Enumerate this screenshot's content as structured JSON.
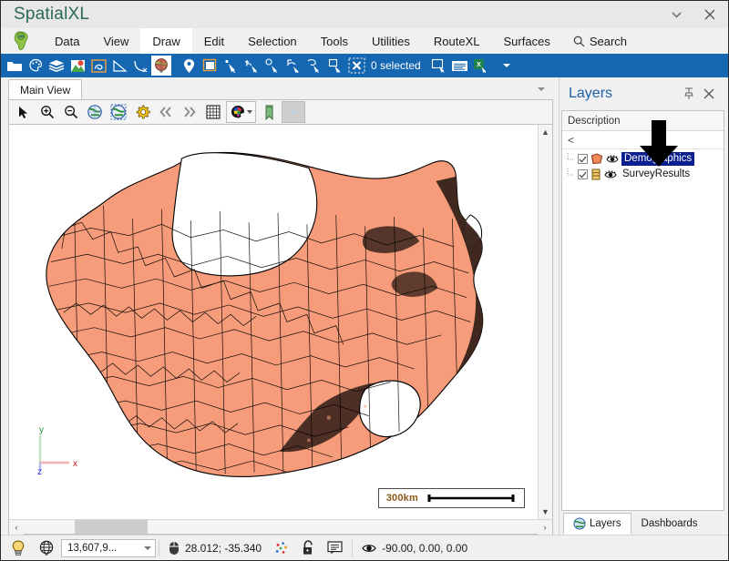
{
  "window": {
    "title": "SpatialXL",
    "minimize_label": "▾",
    "close_label": "✕"
  },
  "menu": {
    "app_icon": "africa-globe-icon",
    "items": [
      {
        "label": "Data",
        "active": false
      },
      {
        "label": "View",
        "active": true
      },
      {
        "label": "Draw",
        "active": false
      },
      {
        "label": "Edit",
        "active": false
      },
      {
        "label": "Selection",
        "active": false
      },
      {
        "label": "Tools",
        "active": false
      },
      {
        "label": "Utilities",
        "active": false
      },
      {
        "label": "RouteXL",
        "active": false
      },
      {
        "label": "Surfaces",
        "active": false
      }
    ],
    "search_label": "Search",
    "search_icon": "search-icon"
  },
  "ribbon": {
    "background": "#1567b2",
    "selection_count": "0 selected",
    "icons": [
      "open-folder-icon",
      "palette-pin-icon",
      "layers-stack-icon",
      "map-pin-image-icon",
      "browse-data-icon",
      "measure-angle-icon",
      "measure-curve-icon",
      "globe-icon",
      "place-marker-icon",
      "image-frame-icon",
      "select-point-icon",
      "select-move-icon",
      "select-rect-icon",
      "select-circle-icon",
      "select-lasso-icon",
      "select-box-icon",
      "clear-selection-icon",
      "duplicate-selection-icon",
      "table-view-icon",
      "export-excel-icon",
      "ribbon-overflow-caret"
    ]
  },
  "view_tabs": {
    "tabs": [
      {
        "label": "Main View",
        "active": true
      }
    ],
    "overflow_icon": "chevron-down-icon"
  },
  "view_toolbar": {
    "icons": [
      "arrow-select-icon",
      "zoom-in-icon",
      "zoom-out-icon",
      "globe-zoom-extent-icon",
      "globe-zoom-selection-icon",
      "settings-gear-icon",
      "previous-extent-icon",
      "next-extent-icon",
      "grid-icon",
      "color-theme-icon",
      "bookmark-icon",
      "sparkle-icon"
    ]
  },
  "map": {
    "background": "#ffffff",
    "polygon_fill": "#f79c7a",
    "polygon_dense_fill": "#3a241c",
    "polygon_stroke": "#000000",
    "scalebar_text": "300km",
    "axis": {
      "x_label": "x",
      "x_color": "#e02020",
      "y_label": "y",
      "y_color": "#1b8f2e",
      "z_label": "z",
      "z_color": "#2222dd"
    },
    "vscroll": {
      "up": "▲",
      "down": "▼"
    },
    "hscroll": {
      "left": "‹",
      "right": "›"
    }
  },
  "layers_panel": {
    "title": "Layers",
    "pin_icon": "pin-icon",
    "close_icon": "close-icon",
    "column_header": "Description",
    "filter_value": "<",
    "annotation_arrow": "down-arrow-annotation",
    "layers": [
      {
        "name": "Demographics",
        "checked": true,
        "selected": true,
        "type_icon": "polygon-layer-icon",
        "visibility_icon": "eye-icon"
      },
      {
        "name": "SurveyResults",
        "checked": true,
        "selected": false,
        "type_icon": "table-layer-icon",
        "visibility_icon": "eye-icon"
      }
    ],
    "tabs": [
      {
        "label": "Layers",
        "active": true,
        "icon": "globe-icon"
      },
      {
        "label": "Dashboards",
        "active": false,
        "icon": ""
      }
    ]
  },
  "statusbar": {
    "hint_icon": "lightbulb-icon",
    "projection_icon": "globe-wire-icon",
    "scale_value": "13,607,9...",
    "mouse_icon": "mouse-icon",
    "coordinates": "28.012; -35.340",
    "snap_icon": "snapping-icon",
    "lock_icon": "lock-icon",
    "notes_icon": "notes-icon",
    "view_icon": "eye-icon",
    "camera_values": "-90.00, 0.00, 0.00"
  }
}
